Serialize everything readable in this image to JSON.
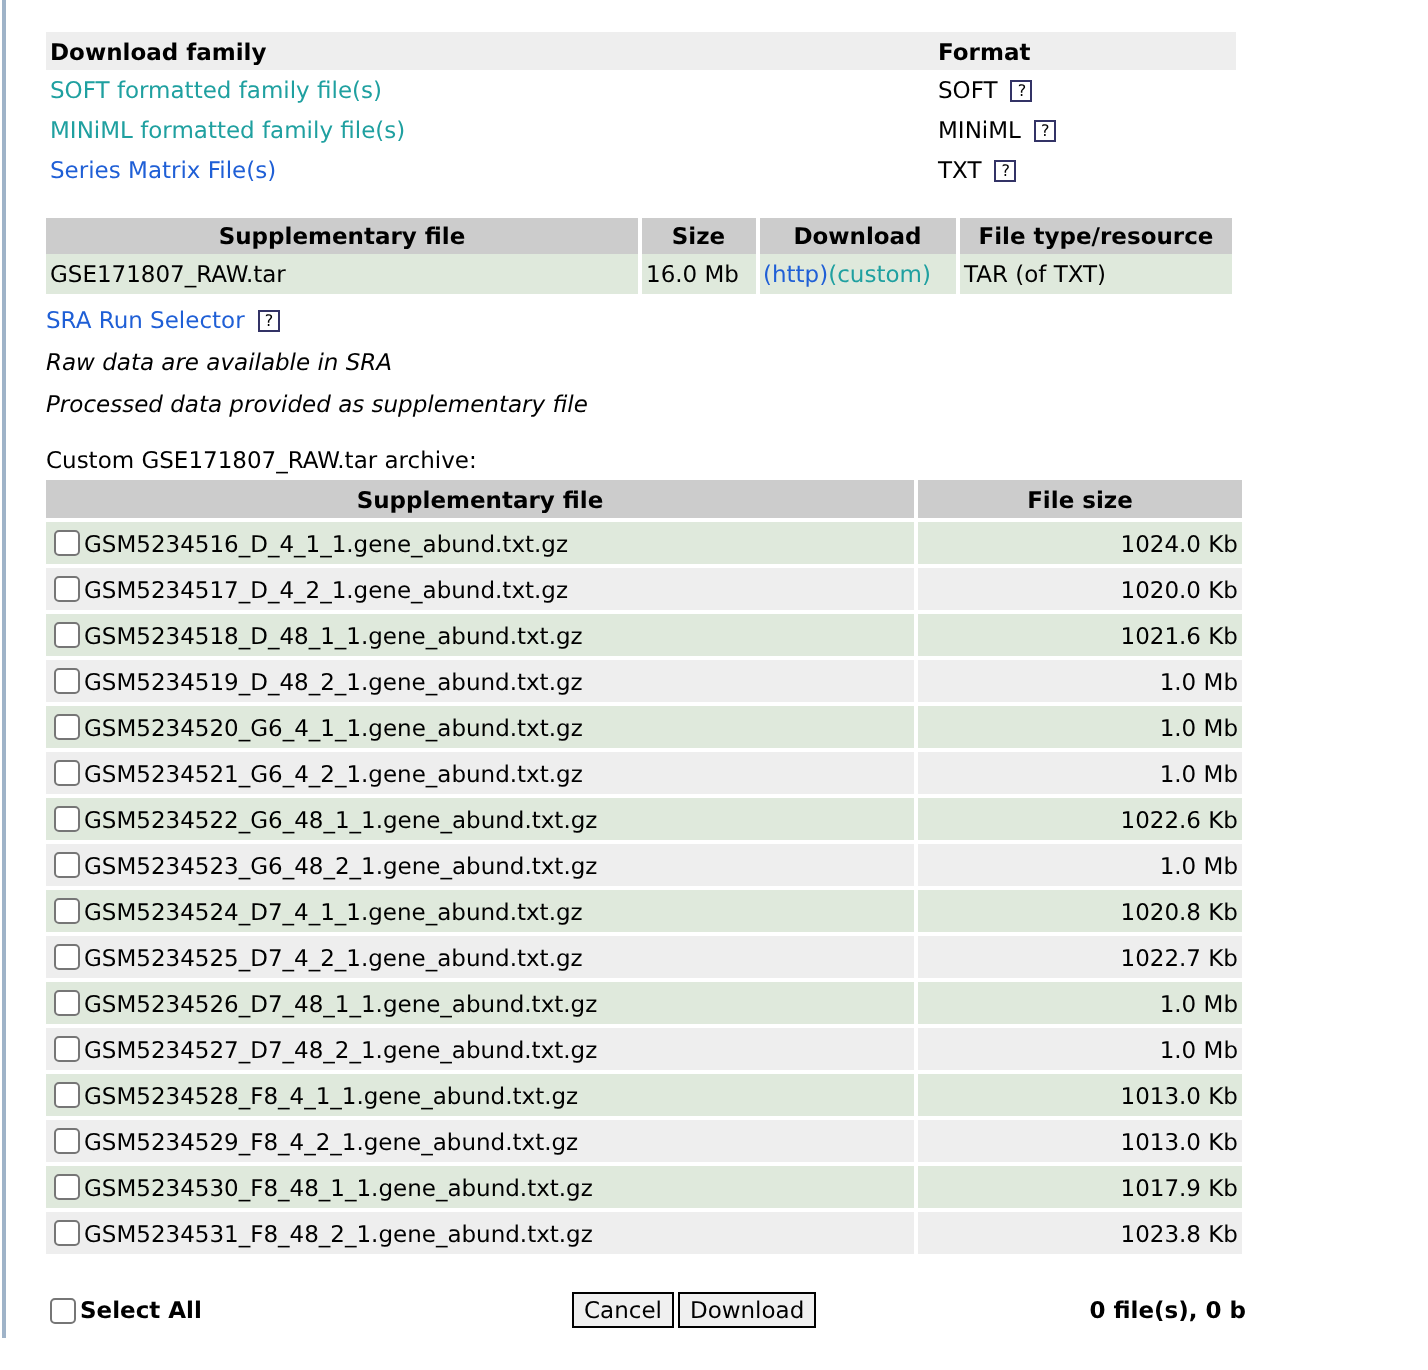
{
  "family": {
    "columns": [
      "Download family",
      "Format"
    ],
    "rows": [
      {
        "label": "SOFT formatted family file(s)",
        "visited": true,
        "format": "SOFT",
        "help": "?"
      },
      {
        "label": "MINiML formatted family file(s)",
        "visited": true,
        "format": "MINiML",
        "help": "?"
      },
      {
        "label": "Series Matrix File(s)",
        "visited": false,
        "format": "TXT",
        "help": "?"
      }
    ]
  },
  "supplementary": {
    "columns": [
      "Supplementary file",
      "Size",
      "Download",
      "File type/resource"
    ],
    "rows": [
      {
        "file": "GSE171807_RAW.tar",
        "size": "16.0 Mb",
        "links": [
          {
            "label": "(http)",
            "visited": false
          },
          {
            "label": "(custom)",
            "visited": true
          }
        ],
        "type": "TAR (of TXT)"
      }
    ]
  },
  "sra": {
    "label": "SRA Run Selector",
    "help": "?"
  },
  "notes": [
    "Raw data are available in SRA",
    "Processed data provided as supplementary file"
  ],
  "archive": {
    "caption": "Custom GSE171807_RAW.tar archive:",
    "columns": [
      "Supplementary file",
      "File size"
    ],
    "rows": [
      {
        "file": "GSM5234516_D_4_1_1.gene_abund.txt.gz",
        "size": "1024.0 Kb",
        "checked": false
      },
      {
        "file": "GSM5234517_D_4_2_1.gene_abund.txt.gz",
        "size": "1020.0 Kb",
        "checked": false
      },
      {
        "file": "GSM5234518_D_48_1_1.gene_abund.txt.gz",
        "size": "1021.6 Kb",
        "checked": false
      },
      {
        "file": "GSM5234519_D_48_2_1.gene_abund.txt.gz",
        "size": "1.0 Mb",
        "checked": false
      },
      {
        "file": "GSM5234520_G6_4_1_1.gene_abund.txt.gz",
        "size": "1.0 Mb",
        "checked": false
      },
      {
        "file": "GSM5234521_G6_4_2_1.gene_abund.txt.gz",
        "size": "1.0 Mb",
        "checked": false
      },
      {
        "file": "GSM5234522_G6_48_1_1.gene_abund.txt.gz",
        "size": "1022.6 Kb",
        "checked": false
      },
      {
        "file": "GSM5234523_G6_48_2_1.gene_abund.txt.gz",
        "size": "1.0 Mb",
        "checked": false
      },
      {
        "file": "GSM5234524_D7_4_1_1.gene_abund.txt.gz",
        "size": "1020.8 Kb",
        "checked": false
      },
      {
        "file": "GSM5234525_D7_4_2_1.gene_abund.txt.gz",
        "size": "1022.7 Kb",
        "checked": false
      },
      {
        "file": "GSM5234526_D7_48_1_1.gene_abund.txt.gz",
        "size": "1.0 Mb",
        "checked": false
      },
      {
        "file": "GSM5234527_D7_48_2_1.gene_abund.txt.gz",
        "size": "1.0 Mb",
        "checked": false
      },
      {
        "file": "GSM5234528_F8_4_1_1.gene_abund.txt.gz",
        "size": "1013.0 Kb",
        "checked": false
      },
      {
        "file": "GSM5234529_F8_4_2_1.gene_abund.txt.gz",
        "size": "1013.0 Kb",
        "checked": false
      },
      {
        "file": "GSM5234530_F8_48_1_1.gene_abund.txt.gz",
        "size": "1017.9 Kb",
        "checked": false
      },
      {
        "file": "GSM5234531_F8_48_2_1.gene_abund.txt.gz",
        "size": "1023.8 Kb",
        "checked": false
      }
    ]
  },
  "footer": {
    "select_all": {
      "label": "Select All",
      "checked": false
    },
    "buttons": [
      "Cancel",
      "Download"
    ],
    "summary": "0 file(s), 0 b"
  }
}
